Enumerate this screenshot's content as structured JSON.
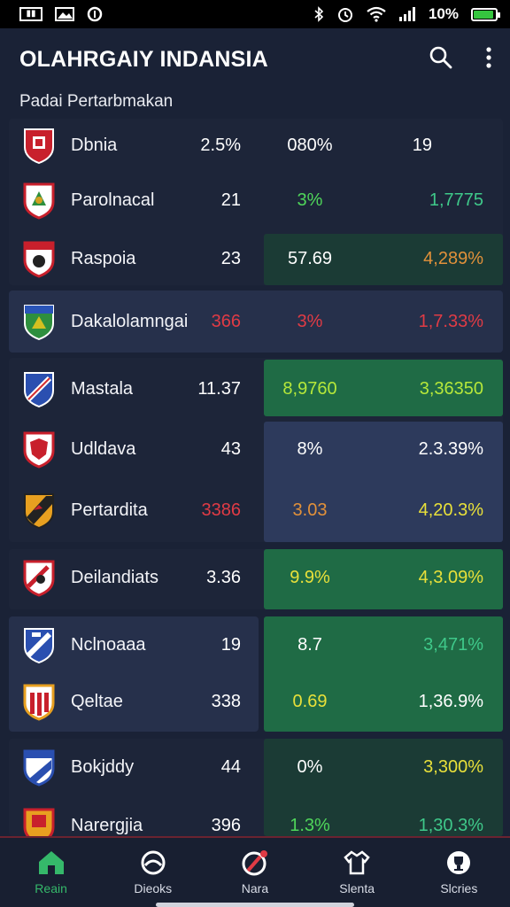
{
  "status_bar": {
    "battery_text": "10%"
  },
  "header": {
    "title": "OLAHRGAIY INDANSIA"
  },
  "section": {
    "label": "Padai Pertarbmakan"
  },
  "rows": [
    {
      "team": "Dbnia",
      "c1": "2.5%",
      "c2": "080%",
      "c3": "19"
    },
    {
      "team": "Parolnacal",
      "c1": "21",
      "c2": "3%",
      "c3": "1,7775"
    },
    {
      "team": "Raspoia",
      "c1": "23",
      "c2": "57.69",
      "c3": "4,289%"
    },
    {
      "team": "Dakalolamngai",
      "c1": "366",
      "c2": "3%",
      "c3": "1,7.33%"
    },
    {
      "team": "Mastala",
      "c1": "11.37",
      "c2": "8,9760",
      "c3": "3,36350"
    },
    {
      "team": "Udldava",
      "c1": "43",
      "c2": "8%",
      "c3": "2.3.39%"
    },
    {
      "team": "Pertardita",
      "c1": "3386",
      "c2": "3.03",
      "c3": "4,20.3%"
    },
    {
      "team": "Deilandiats",
      "c1": "3.36",
      "c2": "9.9%",
      "c3": "4,3.09%"
    },
    {
      "team": "Nclnoaaa",
      "c1": "19",
      "c2": "8.7",
      "c3": "3,471%"
    },
    {
      "team": "Qeltae",
      "c1": "338",
      "c2": "0.69",
      "c3": "1,36.9%"
    },
    {
      "team": "Bokjddy",
      "c1": "44",
      "c2": "0%",
      "c3": "3,300%"
    },
    {
      "team": "Narergjia",
      "c1": "396",
      "c2": "1.3%",
      "c3": "1,30.3%"
    }
  ],
  "nav": [
    {
      "label": "Reain",
      "icon": "home-icon"
    },
    {
      "label": "Dieoks",
      "icon": "ball-icon"
    },
    {
      "label": "Nara",
      "icon": "notification-icon"
    },
    {
      "label": "Slenta",
      "icon": "jersey-icon"
    },
    {
      "label": "Slcries",
      "icon": "trophy-icon"
    }
  ],
  "colors": {
    "background": "#1a2236",
    "accent_green": "#35b86a",
    "red": "#e03b45",
    "yellow": "#e8e03a"
  }
}
